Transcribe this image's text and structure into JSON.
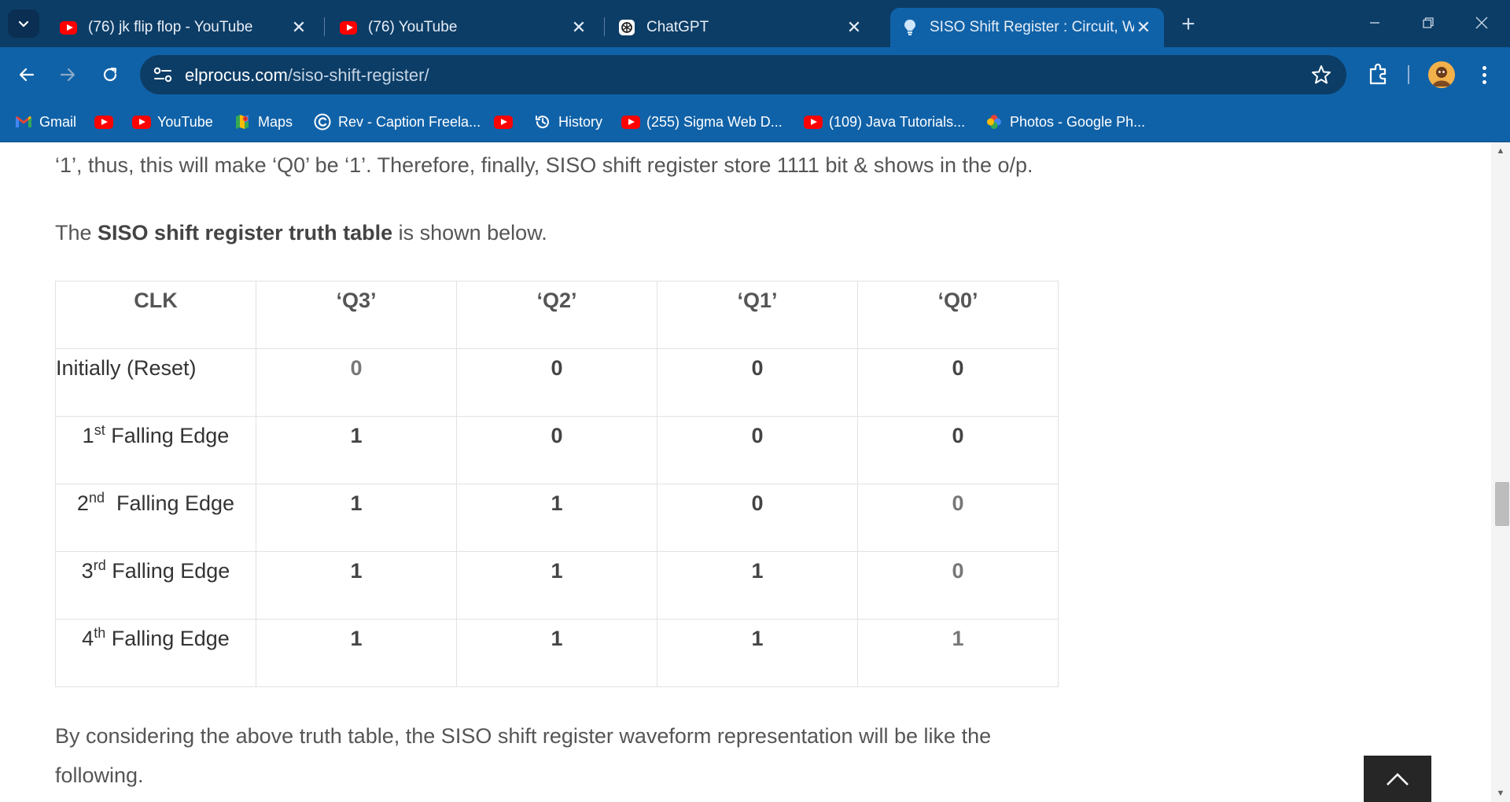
{
  "browser": {
    "tabs": [
      {
        "title": "(76) jk flip flop - YouTube",
        "icon": "youtube-icon"
      },
      {
        "title": "(76) YouTube",
        "icon": "youtube-icon"
      },
      {
        "title": "ChatGPT",
        "icon": "chatgpt-icon"
      },
      {
        "title": "SISO Shift Register : Circuit, Wo",
        "icon": "bulb-icon",
        "active": true
      }
    ],
    "url_domain": "elprocus.com",
    "url_path": "/siso-shift-register/",
    "bookmarks": [
      {
        "label": "Gmail",
        "icon": "gmail-icon"
      },
      {
        "label": "",
        "icon": "youtube-icon"
      },
      {
        "label": "YouTube",
        "icon": "youtube-icon"
      },
      {
        "label": "Maps",
        "icon": "maps-icon"
      },
      {
        "label": "Rev - Caption Freela...",
        "icon": "rev-icon"
      },
      {
        "label": "",
        "icon": "youtube-icon"
      },
      {
        "label": "History",
        "icon": "history-icon"
      },
      {
        "label": "(255) Sigma Web D...",
        "icon": "youtube-icon"
      },
      {
        "label": "(109) Java Tutorials...",
        "icon": "youtube-icon"
      },
      {
        "label": "Photos - Google Ph...",
        "icon": "google-photos-icon"
      }
    ]
  },
  "article": {
    "intro_line": "‘1’, thus, this will make ‘Q0’ be ‘1’. Therefore, finally, SISO shift register store 1111 bit & shows in the o/p.",
    "table_intro_pre": "The ",
    "table_intro_bold": "SISO shift register truth table",
    "table_intro_post": " is shown below.",
    "table": {
      "headers": [
        "CLK",
        "‘Q3’",
        "‘Q2’",
        "‘Q1’",
        "‘Q0’"
      ],
      "rows": [
        {
          "num": "",
          "sup": "",
          "label": "Initially (Reset)",
          "values": [
            "0",
            "0",
            "0",
            "0"
          ]
        },
        {
          "num": "1",
          "sup": "st",
          "label": " Falling Edge",
          "values": [
            "1",
            "0",
            "0",
            "0"
          ]
        },
        {
          "num": "2",
          "sup": "nd",
          "label": "  Falling Edge",
          "values": [
            "1",
            "1",
            "0",
            "0"
          ]
        },
        {
          "num": "3",
          "sup": "rd",
          "label": " Falling Edge",
          "values": [
            "1",
            "1",
            "1",
            "0"
          ]
        },
        {
          "num": "4",
          "sup": "th",
          "label": " Falling Edge",
          "values": [
            "1",
            "1",
            "1",
            "1"
          ]
        }
      ]
    },
    "outro_line1": "By considering the above truth table, the SISO shift register waveform representation will be like the",
    "outro_line2": "following."
  }
}
